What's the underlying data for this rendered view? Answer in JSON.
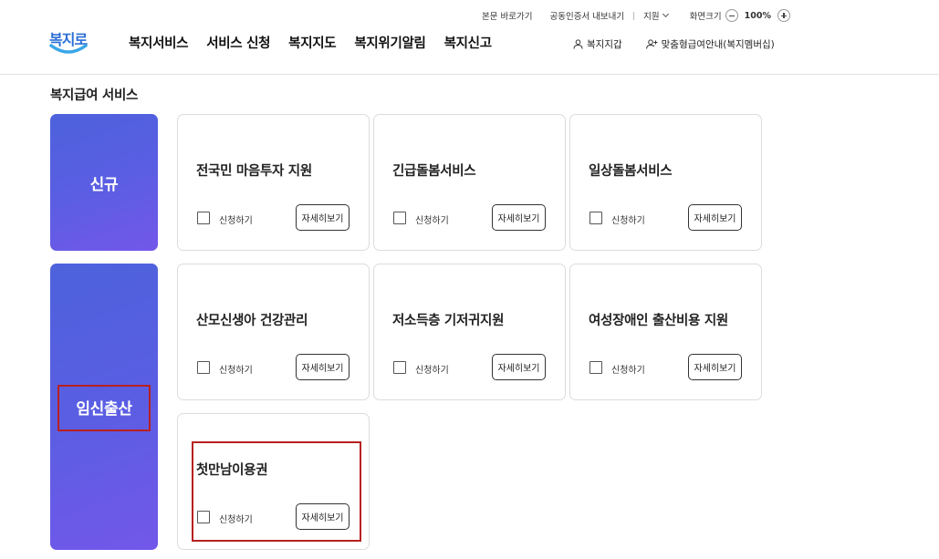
{
  "header": {
    "logo_text": "복지로",
    "utility_links": [
      "본문 바로가기",
      "공동인증서 내보내기"
    ],
    "support_label": "지원",
    "zoom_label": "화면크기",
    "zoom_value": "100%",
    "nav": [
      "복지서비스",
      "서비스 신청",
      "복지지도",
      "복지위기알림",
      "복지신고"
    ],
    "user_links": [
      "복지지갑",
      "맞춤형급여안내(복지멤버십)"
    ]
  },
  "main": {
    "section_title": "복지급여 서비스",
    "categories": [
      {
        "label": "신규",
        "services": [
          "전국민 마음투자 지원",
          "긴급돌봄서비스",
          "일상돌봄서비스"
        ]
      },
      {
        "label": "임신출산",
        "services": [
          "산모신생아 건강관리",
          "저소득층 기저귀지원",
          "여성장애인 출산비용 지원",
          "첫만남이용권"
        ]
      }
    ],
    "apply_label": "신청하기",
    "detail_label": "자세히보기"
  },
  "colors": {
    "category_gradient_start": "#4d62dc",
    "category_gradient_end": "#7357ea",
    "highlight_border": "#b82020",
    "logo_blue": "#2c6fd6"
  }
}
